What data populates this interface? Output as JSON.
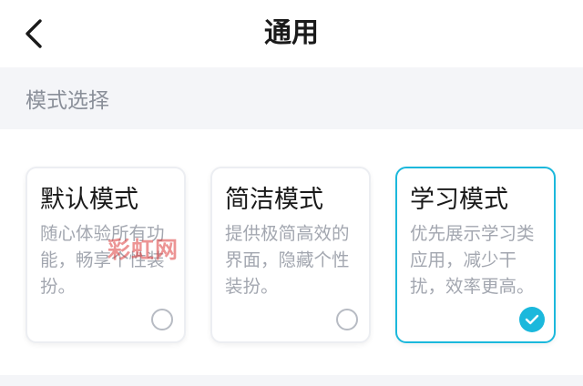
{
  "nav": {
    "title": "通用",
    "back_icon": "chevron-left-icon"
  },
  "section": {
    "label": "模式选择"
  },
  "modes": [
    {
      "title": "默认模式",
      "description": "随心体验所有功能，畅享个性装扮。",
      "selected": false
    },
    {
      "title": "简洁模式",
      "description": "提供极简高效的界面，隐藏个性装扮。",
      "selected": false
    },
    {
      "title": "学习模式",
      "description": "优先展示学习类应用，减少干扰，效率更高。",
      "selected": true
    }
  ],
  "watermark": {
    "text": "彩虹网"
  },
  "colors": {
    "accent": "#1bb8dc",
    "section_bg": "#f4f5f8",
    "title_text": "#1a1a1a",
    "desc_text": "#a3a7b0"
  }
}
